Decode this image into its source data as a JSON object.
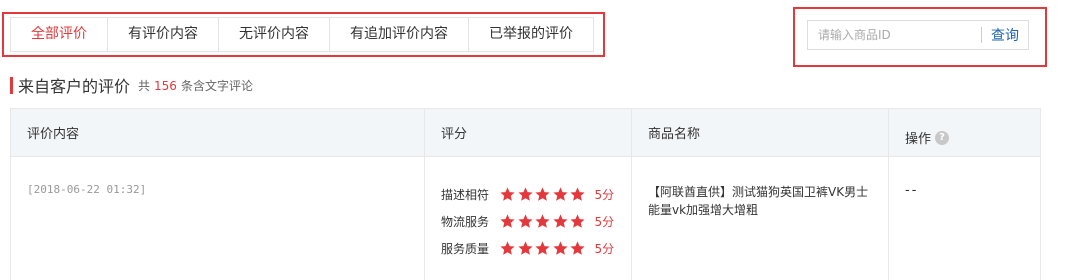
{
  "tabs": [
    {
      "label": "全部评价",
      "active": true
    },
    {
      "label": "有评价内容",
      "active": false
    },
    {
      "label": "无评价内容",
      "active": false
    },
    {
      "label": "有追加评价内容",
      "active": false
    },
    {
      "label": "已举报的评价",
      "active": false
    }
  ],
  "search": {
    "placeholder": "请输入商品ID",
    "value": "",
    "button_label": "查询"
  },
  "section": {
    "title": "来自客户的评价",
    "count_prefix": "共",
    "count": "156",
    "count_suffix": "条含文字评论"
  },
  "table": {
    "headers": {
      "content": "评价内容",
      "rating": "评分",
      "product": "商品名称",
      "action": "操作",
      "help_icon": "question-circle-icon"
    },
    "rows": [
      {
        "time": "[2018-06-22 01:32]",
        "ratings": [
          {
            "label": "描述相符",
            "stars": 5,
            "score": "5分"
          },
          {
            "label": "物流服务",
            "stars": 5,
            "score": "5分"
          },
          {
            "label": "服务质量",
            "stars": 5,
            "score": "5分"
          }
        ],
        "product": "【阿联酋直供】测试猫狗英国卫裤VK男士能量vk加强增大增粗",
        "action": "--"
      }
    ]
  },
  "colors": {
    "accent": "#e4393c",
    "link": "#1f64b0",
    "header_bg": "#f3f6f9",
    "star": "#e4393c"
  }
}
